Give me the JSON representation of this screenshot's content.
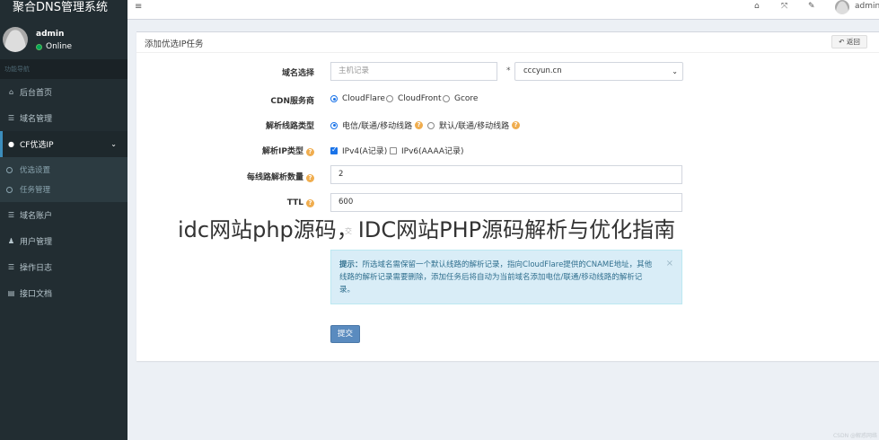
{
  "app": {
    "brand": "聚合DNS管理系统"
  },
  "user": {
    "name": "admin",
    "status": "Online"
  },
  "sidebar": {
    "header": "功能导航",
    "items": [
      {
        "label": "后台首页",
        "icon": "home-icon"
      },
      {
        "label": "域名管理",
        "icon": "list-icon"
      },
      {
        "label": "CF优选IP",
        "icon": "cloud-icon",
        "active": true,
        "children": [
          {
            "label": "优选设置"
          },
          {
            "label": "任务管理"
          }
        ]
      },
      {
        "label": "域名账户",
        "icon": "list-icon"
      },
      {
        "label": "用户管理",
        "icon": "user-icon"
      },
      {
        "label": "操作日志",
        "icon": "list-icon"
      },
      {
        "label": "接口文档",
        "icon": "doc-icon"
      }
    ]
  },
  "topbar": {
    "user": "admin",
    "icons": [
      "menu-icon",
      "home-icon",
      "expand-icon",
      "wrench-icon"
    ]
  },
  "page": {
    "title": "添加优选IP任务",
    "back_label": "返回",
    "fields": {
      "domain": {
        "label": "域名选择",
        "placeholder": "主机记录",
        "separator": "*",
        "selected": "cccyun.cn"
      },
      "cdn": {
        "label": "CDN服务商",
        "options": [
          "CloudFlare",
          "CloudFront",
          "Gcore"
        ],
        "selected": "CloudFlare"
      },
      "line": {
        "label": "解析线路类型",
        "options": [
          "电信/联通/移动线路",
          "默认/联通/移动线路"
        ],
        "selected": "电信/联通/移动线路"
      },
      "iptype": {
        "label": "解析IP类型",
        "options": [
          "IPv4(A记录)",
          "IPv6(AAAA记录)"
        ],
        "checked": [
          "IPv4(A记录)"
        ]
      },
      "count": {
        "label": "每线路解析数量",
        "value": "2"
      },
      "ttl": {
        "label": "TTL",
        "value": "600"
      }
    },
    "faded_text": "交",
    "alert": {
      "title": "提示：",
      "text": "所选域名需保留一个默认线路的解析记录，指向CloudFlare提供的CNAME地址，其他线路的解析记录需要删除，添加任务后将自动为当前域名添加电信/联通/移动线路的解析记录。"
    },
    "submit_label": "提交"
  },
  "overlay": {
    "title": "idc网站php源码，IDC网站PHP源码解析与优化指南",
    "corner": "CSDN @解惑网络"
  }
}
